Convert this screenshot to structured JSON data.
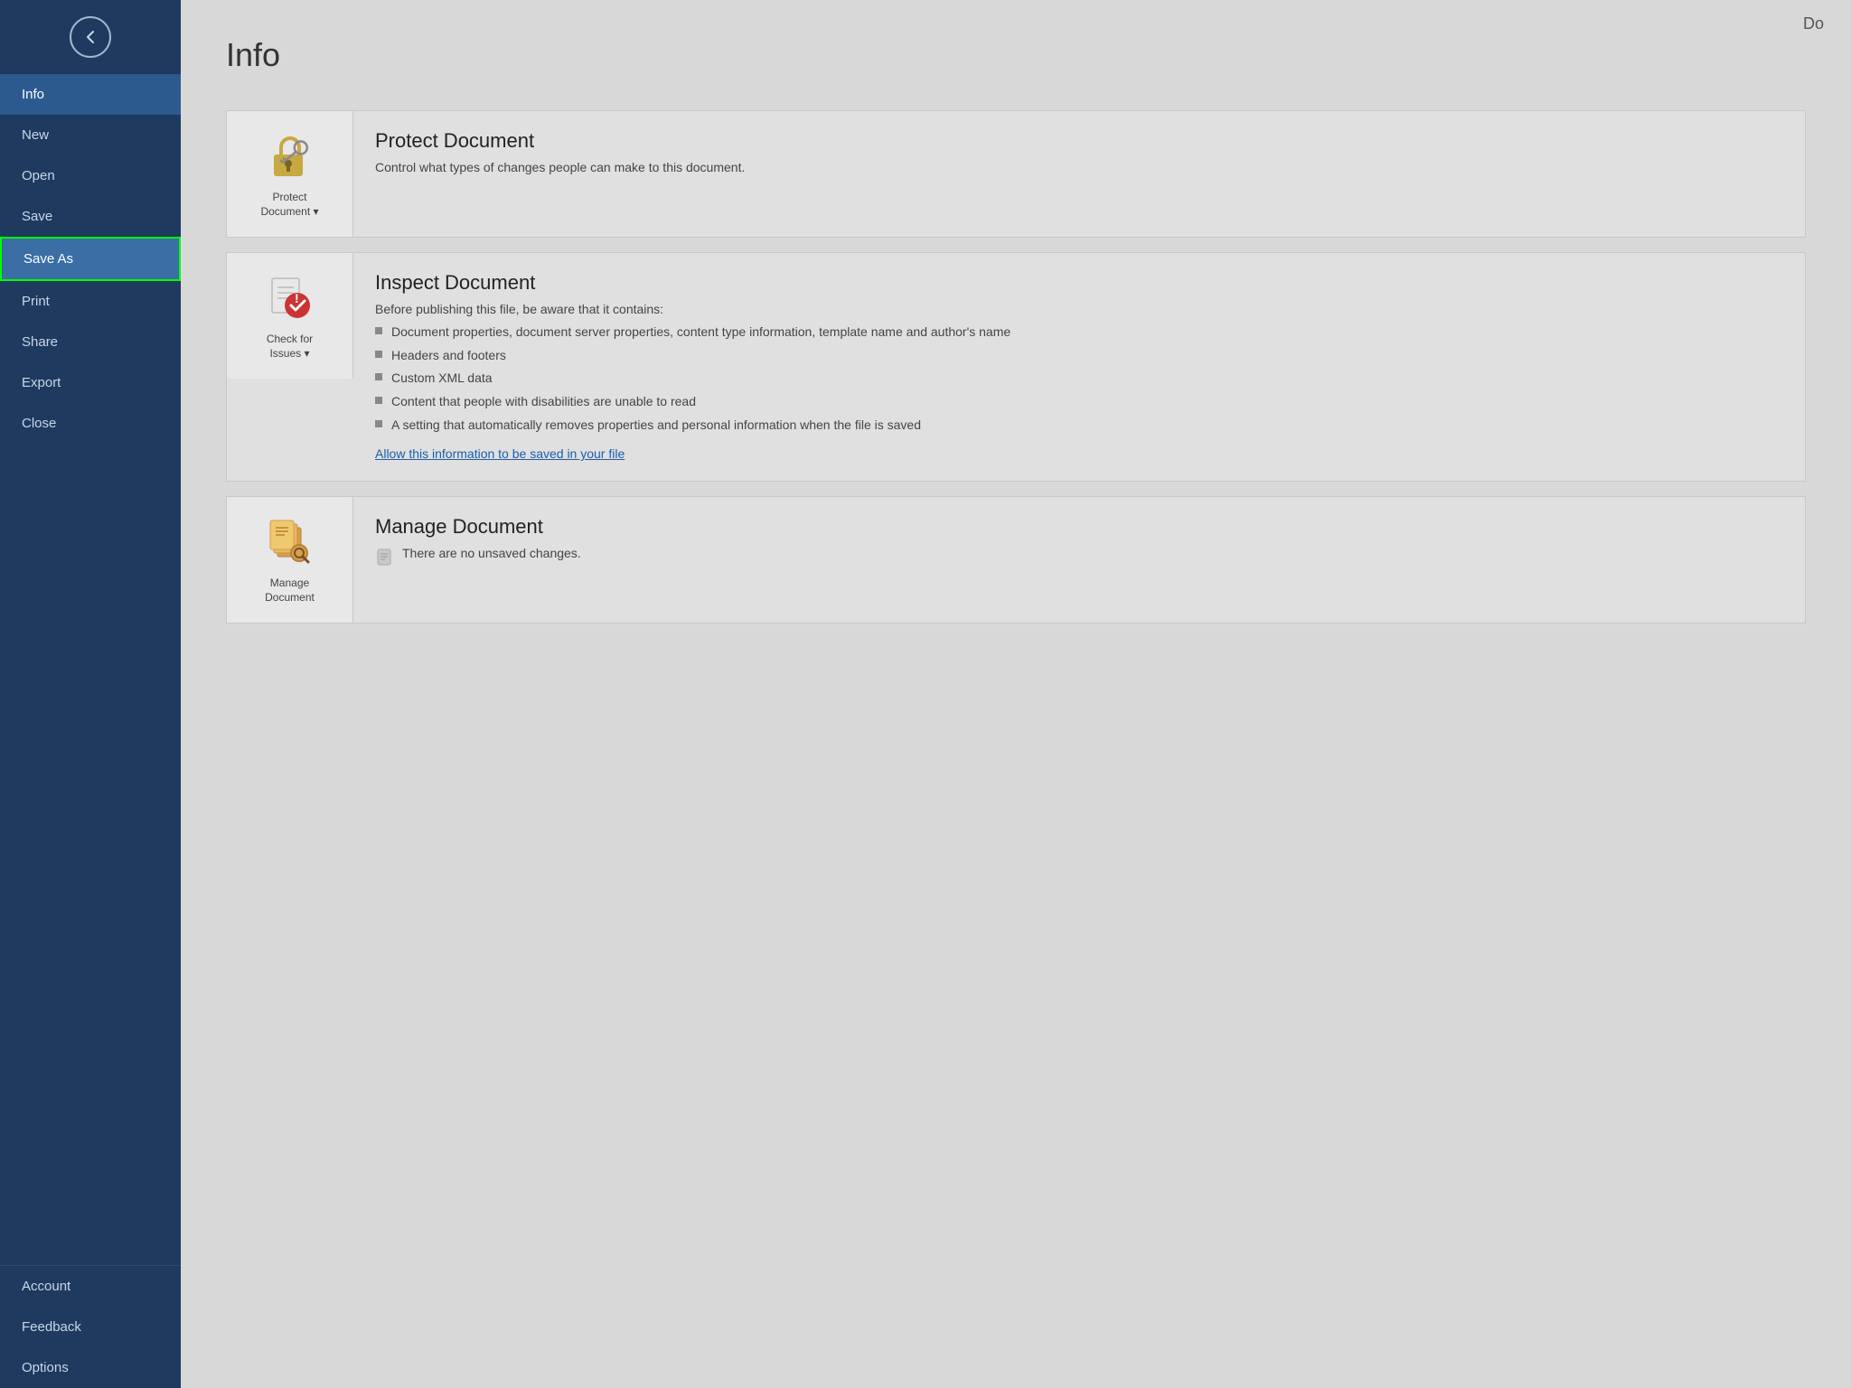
{
  "sidebar": {
    "back_label": "←",
    "items": [
      {
        "id": "info",
        "label": "Info",
        "state": "active"
      },
      {
        "id": "new",
        "label": "New",
        "state": "normal"
      },
      {
        "id": "open",
        "label": "Open",
        "state": "normal"
      },
      {
        "id": "save",
        "label": "Save",
        "state": "normal"
      },
      {
        "id": "save-as",
        "label": "Save As",
        "state": "selected"
      },
      {
        "id": "print",
        "label": "Print",
        "state": "normal"
      },
      {
        "id": "share",
        "label": "Share",
        "state": "normal"
      },
      {
        "id": "export",
        "label": "Export",
        "state": "normal"
      },
      {
        "id": "close",
        "label": "Close",
        "state": "normal"
      }
    ],
    "bottom_items": [
      {
        "id": "account",
        "label": "Account",
        "state": "normal"
      },
      {
        "id": "feedback",
        "label": "Feedback",
        "state": "normal"
      },
      {
        "id": "options",
        "label": "Options",
        "state": "normal"
      }
    ]
  },
  "main": {
    "title": "Info",
    "top_right": "Do",
    "cards": [
      {
        "id": "protect",
        "icon_label": "Protect\nDocument ▾",
        "title": "Protect Document",
        "desc": "Control what types of changes people can make to this document.",
        "bullets": [],
        "link": null
      },
      {
        "id": "inspect",
        "icon_label": "Check for\nIssues ▾",
        "title": "Inspect Document",
        "desc": "Before publishing this file, be aware that it contains:",
        "bullets": [
          "Document properties, document server properties, content type information, template name and author's name",
          "Headers and footers",
          "Custom XML data",
          "Content that people with disabilities are unable to read",
          "A setting that automatically removes properties and personal information when the file is saved"
        ],
        "link": "Allow this information to be saved in your file"
      },
      {
        "id": "manage",
        "icon_label": "Manage\nDocument",
        "title": "Manage Document",
        "desc": "There are no unsaved changes.",
        "bullets": [],
        "link": null
      }
    ]
  }
}
